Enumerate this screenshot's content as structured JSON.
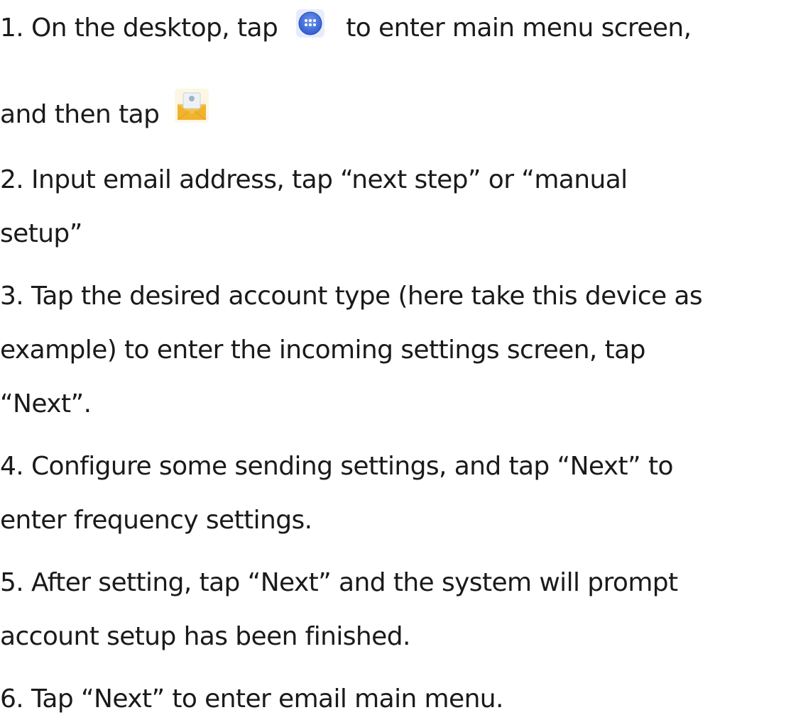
{
  "steps": [
    {
      "before_icon": "1. On the desktop, tap",
      "icon": "apps-icon",
      "after_icon": "to enter main menu screen,"
    },
    {
      "continuation": "and then tap",
      "icon": "email-icon"
    },
    {
      "line1": "2. Input email address, tap “next step” or “manual",
      "line2": "setup”"
    },
    {
      "line1": "3. Tap the desired account type (here take this device as",
      "line2": "example) to enter the incoming settings screen, tap",
      "line3": "“Next”."
    },
    {
      "line1": "4. Configure some sending settings, and tap “Next” to",
      "line2": "enter frequency settings."
    },
    {
      "line1": "5. After setting, tap “Next” and the system will prompt",
      "line2": "account setup has been finished."
    },
    {
      "line1": "6. Tap “Next” to enter email main menu."
    }
  ],
  "colors": {
    "text": "#1a1a1a",
    "apps_icon_blue": "#3f6fe0",
    "email_icon_yellow": "#f5c244"
  }
}
